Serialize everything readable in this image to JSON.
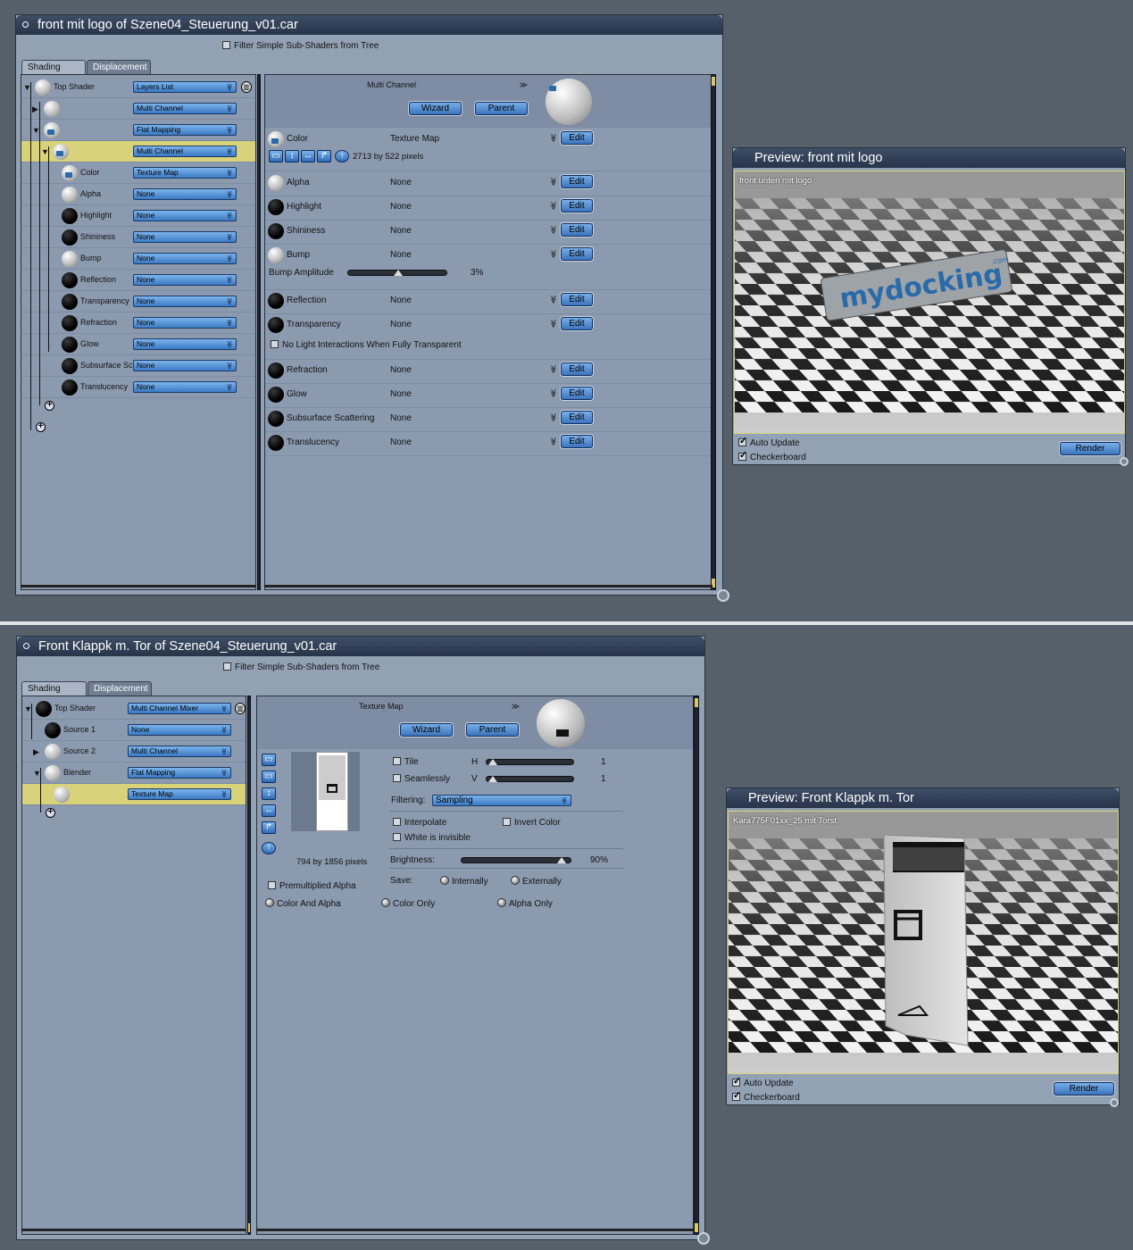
{
  "window1": {
    "title": "front mit logo of Szene04_Steuerung_v01.car",
    "filter_label": "Filter Simple Sub-Shaders from Tree",
    "tabs": [
      "Shading",
      "Displacement"
    ],
    "tree": [
      {
        "label": "Top Shader",
        "value": "Layers List"
      },
      {
        "label": "",
        "value": "Multi Channel"
      },
      {
        "label": "",
        "value": "Flat Mapping"
      },
      {
        "label": "",
        "value": "Multi Channel"
      },
      {
        "label": "Color",
        "value": "Texture Map"
      },
      {
        "label": "Alpha",
        "value": "None"
      },
      {
        "label": "Highlight",
        "value": "None"
      },
      {
        "label": "Shininess",
        "value": "None"
      },
      {
        "label": "Bump",
        "value": "None"
      },
      {
        "label": "Reflection",
        "value": "None"
      },
      {
        "label": "Transparency",
        "value": "None"
      },
      {
        "label": "Refraction",
        "value": "None"
      },
      {
        "label": "Glow",
        "value": "None"
      },
      {
        "label": "Subsurface Sc",
        "value": "None"
      },
      {
        "label": "Translucency",
        "value": "None"
      }
    ],
    "shader_type": "Multi Channel",
    "wizard": "Wizard",
    "parent": "Parent",
    "edit": "Edit",
    "channels": [
      {
        "label": "Color",
        "value": "Texture Map"
      },
      {
        "label": "Alpha",
        "value": "None"
      },
      {
        "label": "Highlight",
        "value": "None"
      },
      {
        "label": "Shininess",
        "value": "None"
      },
      {
        "label": "Bump",
        "value": "None"
      },
      {
        "label": "Reflection",
        "value": "None"
      },
      {
        "label": "Transparency",
        "value": "None"
      },
      {
        "label": "Refraction",
        "value": "None"
      },
      {
        "label": "Glow",
        "value": "None"
      },
      {
        "label": "Subsurface Scattering",
        "value": "None"
      },
      {
        "label": "Translucency",
        "value": "None"
      }
    ],
    "texture_size": "2713 by 522 pixels",
    "bump_amplitude_label": "Bump Amplitude",
    "bump_amplitude_value": "3%",
    "bump_amplitude": 0.5,
    "no_light_label": "No Light Interactions When Fully Transparent"
  },
  "preview1": {
    "title": "Preview: front mit logo",
    "caption": "front unten mit logo",
    "logo_text": "mydocking",
    "logo_suffix": ".com",
    "auto_update": "Auto Update",
    "checkerboard": "Checkerboard",
    "render": "Render"
  },
  "window2": {
    "title": "Front Klappk m. Tor of Szene04_Steuerung_v01.car",
    "filter_label": "Filter Simple Sub-Shaders from Tree",
    "tabs": [
      "Shading",
      "Displacement"
    ],
    "tree": [
      {
        "label": "Top Shader",
        "value": "Multi Channel Mixer"
      },
      {
        "label": "Source 1",
        "value": "None"
      },
      {
        "label": "Source 2",
        "value": "Multi Channel"
      },
      {
        "label": "Blender",
        "value": "Flat Mapping"
      },
      {
        "label": "",
        "value": "Texture Map"
      }
    ],
    "shader_type": "Texture Map",
    "wizard": "Wizard",
    "parent": "Parent",
    "tile": "Tile",
    "seamlessly": "Seamlessly",
    "h_label": "H",
    "v_label": "V",
    "h_value": "1",
    "v_value": "1",
    "filtering_label": "Filtering:",
    "filtering_value": "Sampling",
    "interpolate": "Interpolate",
    "invert_color": "Invert Color",
    "white_invisible": "White is invisible",
    "brightness_label": "Brightness:",
    "brightness_value": "90%",
    "brightness": 0.9,
    "save_label": "Save:",
    "internally": "Internally",
    "externally": "Externally",
    "texture_size": "794 by 1856 pixels",
    "premultiplied": "Premultiplied Alpha",
    "color_and_alpha": "Color And Alpha",
    "color_only": "Color Only",
    "alpha_only": "Alpha Only"
  },
  "preview2": {
    "title": "Preview: Front Klappk m. Tor",
    "caption": "Kara775F01xx_25 mit Torst.",
    "auto_update": "Auto Update",
    "checkerboard": "Checkerboard",
    "render": "Render"
  },
  "colors": {
    "background": "#56606b",
    "panel": "#93a1b4",
    "accent_button": "#4a86d0",
    "selection": "#d8d27a",
    "titlebar": "#2e3c54"
  }
}
